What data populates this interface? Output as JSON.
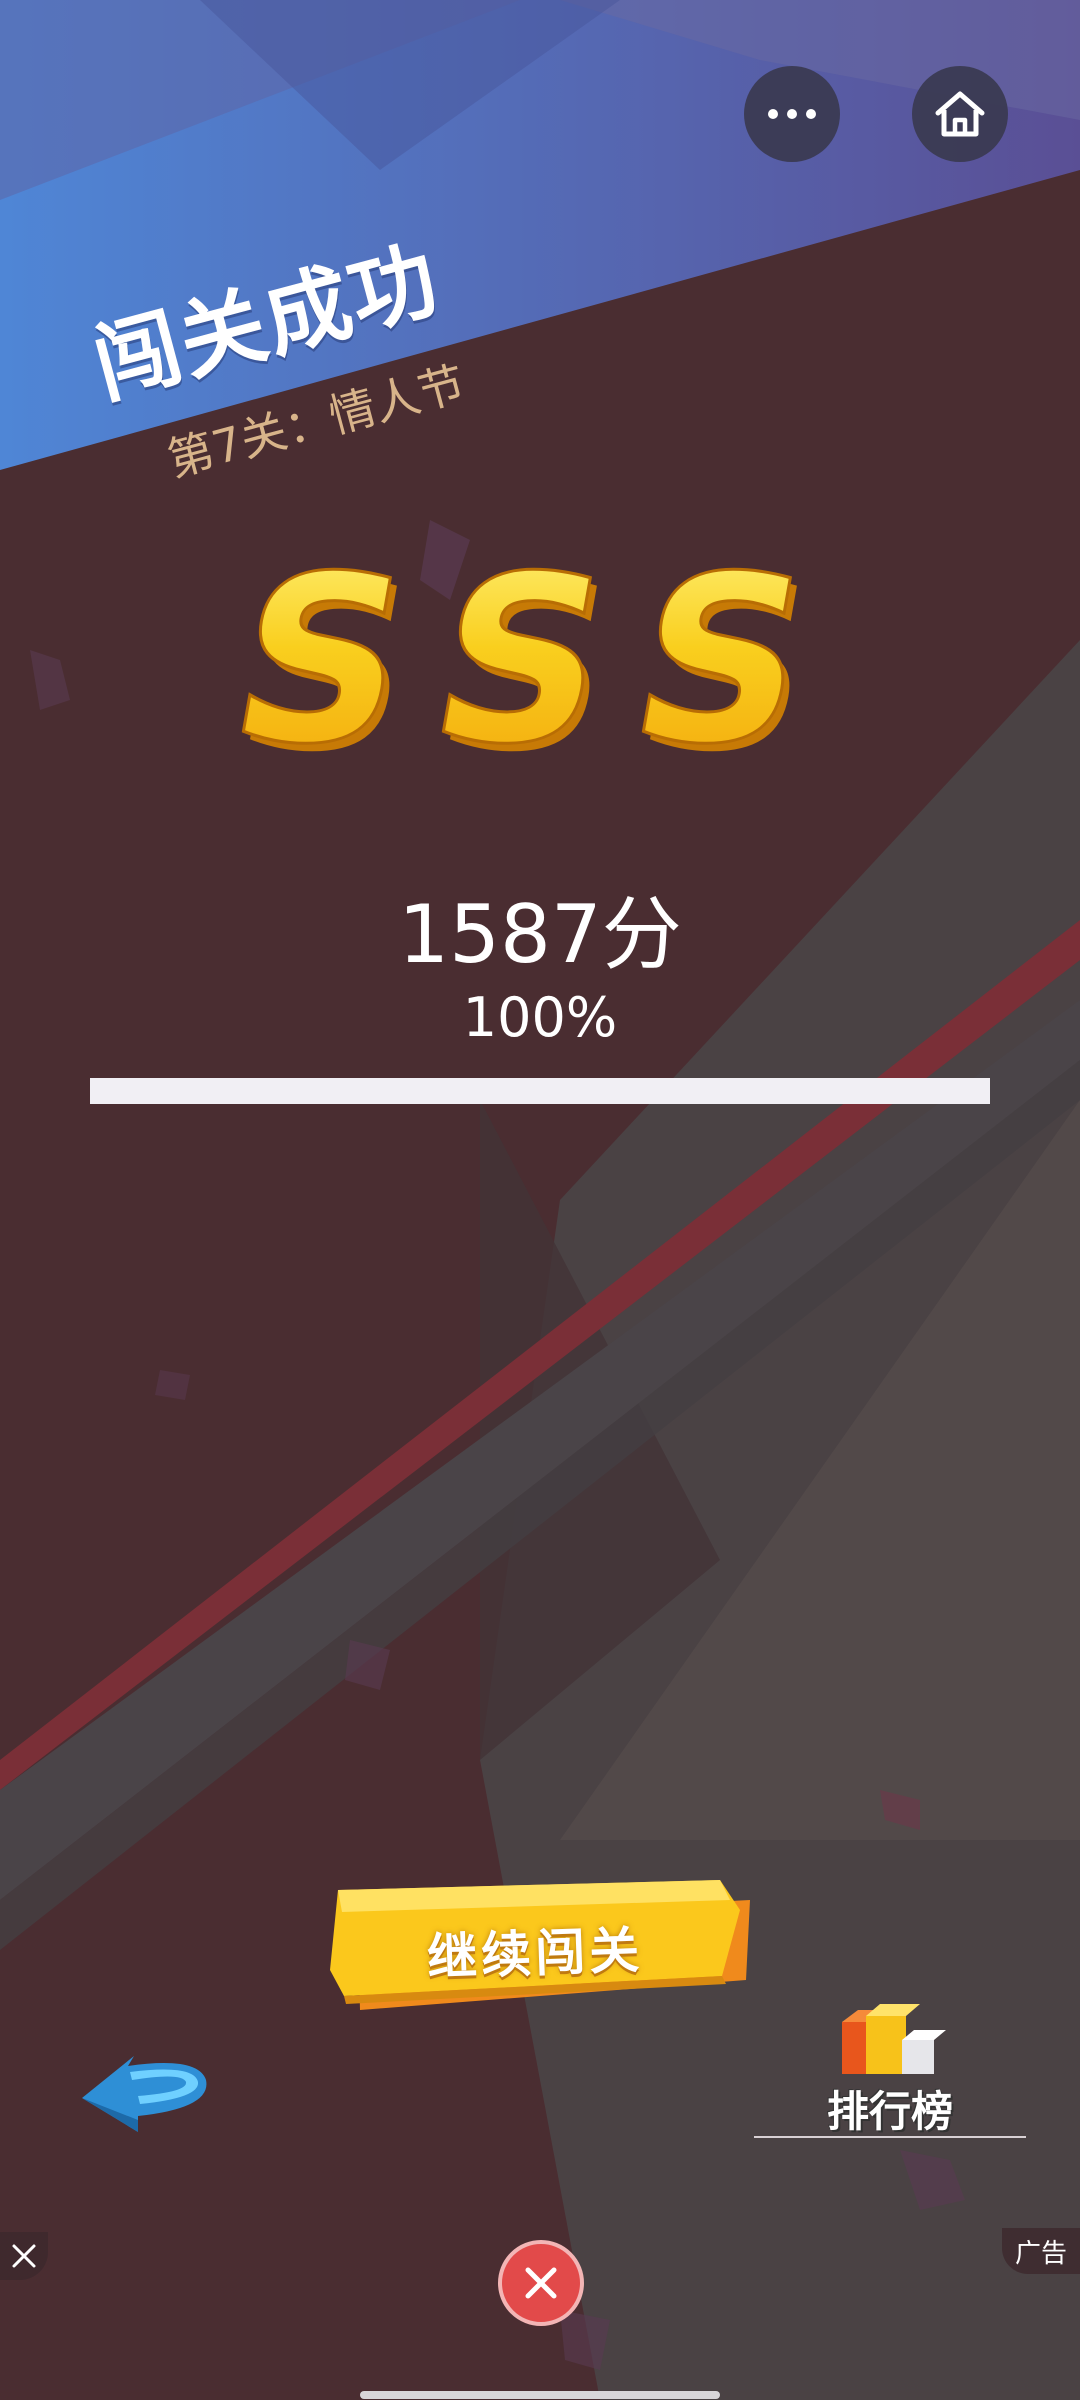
{
  "header": {
    "more_icon": "more-dots-icon",
    "home_icon": "home-icon"
  },
  "result": {
    "title": "闯关成功",
    "level": "第7关：情人节",
    "rank_letters": [
      "S",
      "S",
      "S"
    ],
    "score": "1587分",
    "percent_text": "100%",
    "progress": 1.0
  },
  "actions": {
    "continue_label": "继续闯关",
    "back_icon": "back-arrow-icon",
    "leaderboard_label": "排行榜",
    "leaderboard_icon": "blocks-icon"
  },
  "ad": {
    "label": "广告",
    "close_icon": "close-icon"
  },
  "colors": {
    "background": "#4a2d31",
    "banner_blue": "#4e73c4",
    "gold": "#f7c21a",
    "close_red": "#e24a4a"
  }
}
